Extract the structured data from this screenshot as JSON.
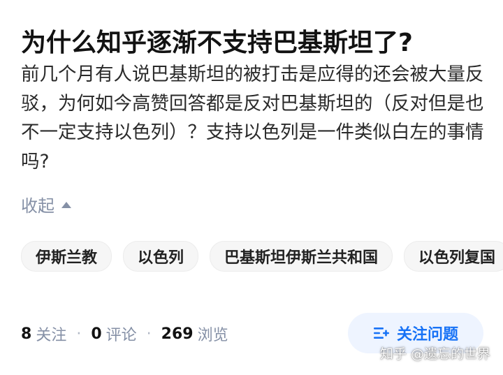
{
  "question": {
    "title": "为什么知乎逐渐不支持巴基斯坦了?",
    "description": "前几个月有人说巴基斯坦的被打击是应得的还会被大量反驳，为何如今高赞回答都是反对巴基斯坦的（反对但是也不一定支持以色列）？支持以色列是一件类似白左的事情吗?",
    "collapse_label": "收起"
  },
  "tags": [
    "伊斯兰教",
    "以色列",
    "巴基斯坦伊斯兰共和国",
    "以色列复国"
  ],
  "stats": {
    "followers_count": "8",
    "followers_label": "关注",
    "comments_count": "0",
    "comments_label": "评论",
    "views_count": "269",
    "views_label": "浏览",
    "separator": "·"
  },
  "follow_button": {
    "label": "关注问题",
    "icon": "add-list-icon"
  },
  "watermark": "知乎 @遗忘的世界",
  "colors": {
    "accent": "#1772f6",
    "button_bg": "#eef4ff",
    "muted": "#8590a6"
  }
}
